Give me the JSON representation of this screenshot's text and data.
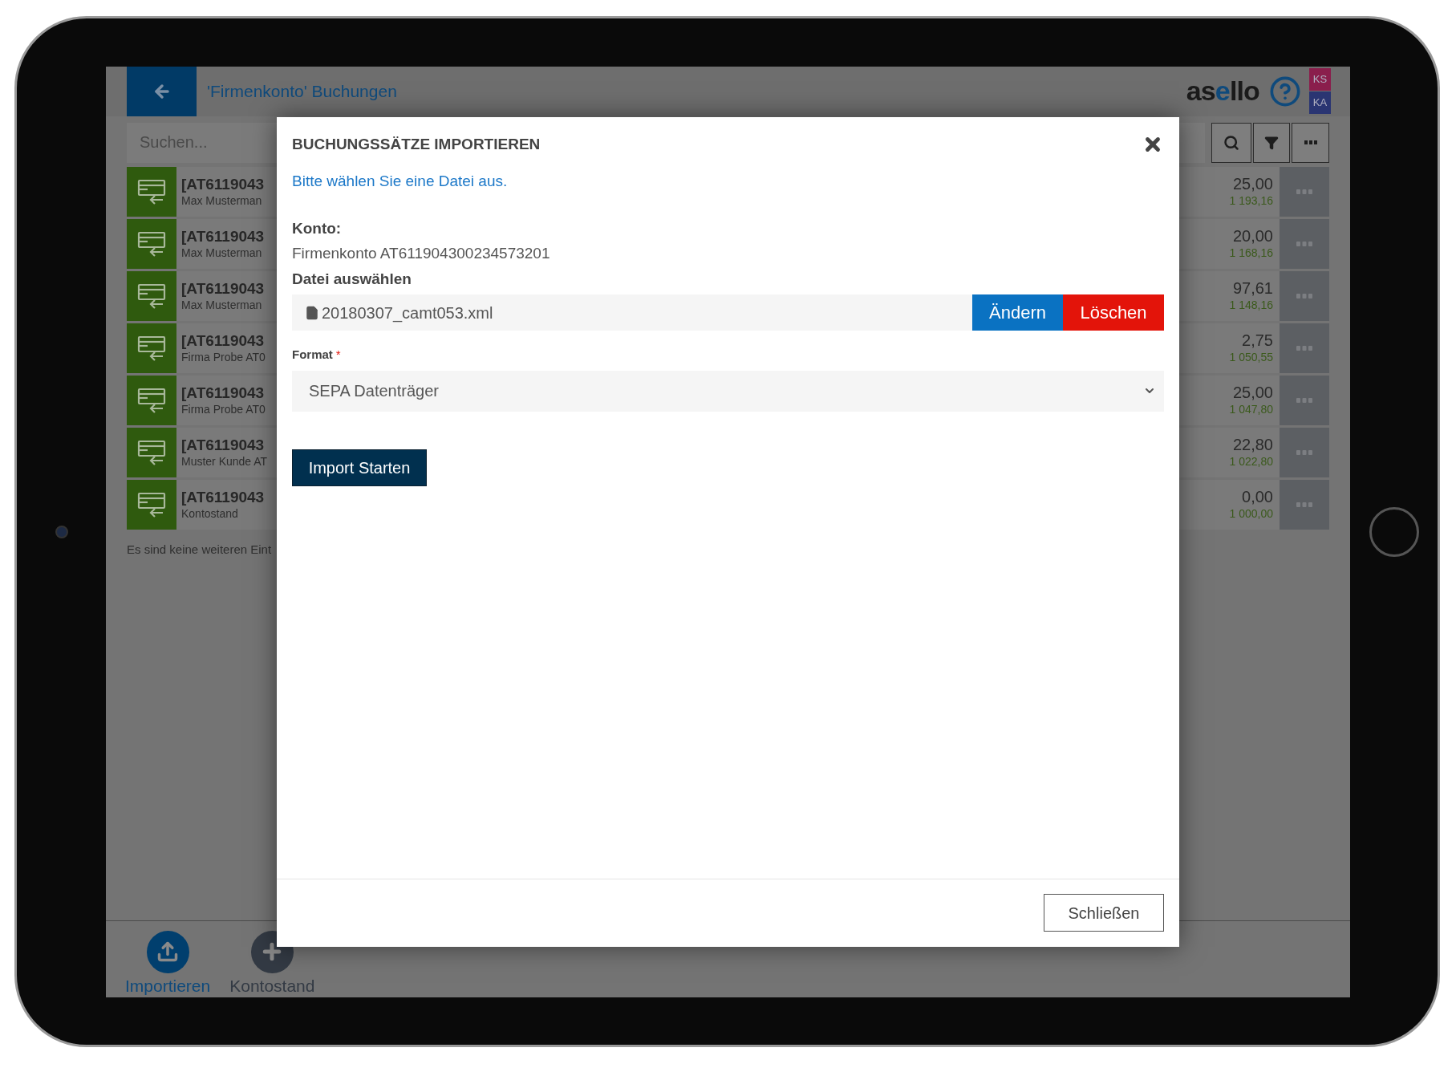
{
  "header": {
    "title": "'Firmenkonto' Buchungen",
    "logo": {
      "before": "as",
      "accent": "e",
      "after": "llo"
    },
    "badges": [
      {
        "label": "KS",
        "color": "#8a1e4c"
      },
      {
        "label": "KA",
        "color": "#2a3572"
      }
    ]
  },
  "search": {
    "placeholder": "Suchen..."
  },
  "rows": [
    {
      "title": "[AT6119043",
      "subtitle": "Max Musterman",
      "amount": "25,00",
      "balance": "1 193,16"
    },
    {
      "title": "[AT6119043",
      "subtitle": "Max Musterman",
      "amount": "20,00",
      "balance": "1 168,16"
    },
    {
      "title": "[AT6119043",
      "subtitle": "Max Musterman",
      "amount": "97,61",
      "balance": "1 148,16"
    },
    {
      "title": "[AT6119043",
      "subtitle": "Firma Probe AT0",
      "amount": "2,75",
      "balance": "1 050,55"
    },
    {
      "title": "[AT6119043",
      "subtitle": "Firma Probe AT0",
      "amount": "25,00",
      "balance": "1 047,80"
    },
    {
      "title": "[AT6119043",
      "subtitle": "Muster Kunde AT",
      "amount": "22,80",
      "balance": "1 022,80"
    },
    {
      "title": "[AT6119043",
      "subtitle": "Kontostand",
      "amount": "0,00",
      "balance": "1 000,00"
    }
  ],
  "list_note": "Es sind keine weiteren Eint",
  "bottom_actions": [
    {
      "label": "Importieren",
      "kind": "upload",
      "selected": true
    },
    {
      "label": "Kontostand",
      "kind": "add",
      "selected": false
    }
  ],
  "dialog": {
    "title": "BUCHUNGSSÄTZE IMPORTIEREN",
    "hint": "Bitte wählen Sie eine Datei aus.",
    "account_label": "Konto:",
    "account_value": "Firmenkonto AT611904300234573201",
    "file_label": "Datei auswählen",
    "file_name": "20180307_camt053.xml",
    "change_button": "Ändern",
    "delete_button": "Löschen",
    "format_label": "Format",
    "required_mark": "*",
    "format_value": "SEPA Datenträger",
    "start_button": "Import Starten",
    "close_button": "Schließen"
  }
}
